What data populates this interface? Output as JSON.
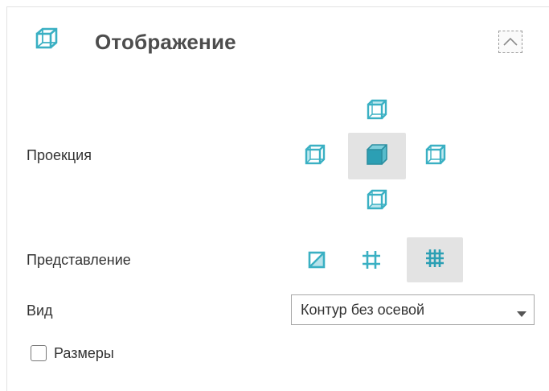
{
  "panel": {
    "title": "Отображение",
    "header_icon": "cube-wireframe-icon",
    "collapse_icon": "chevron-up-icon"
  },
  "projection": {
    "label": "Проекция",
    "options": [
      {
        "icon": "cube-top-view-icon",
        "selected": false
      },
      {
        "icon": "cube-left-view-icon",
        "selected": false
      },
      {
        "icon": "cube-front-view-icon",
        "selected": true
      },
      {
        "icon": "cube-right-view-icon",
        "selected": false
      },
      {
        "icon": "cube-bottom-view-icon",
        "selected": false
      }
    ]
  },
  "representation": {
    "label": "Представление",
    "options": [
      {
        "icon": "shaded-square-icon",
        "selected": false
      },
      {
        "icon": "frame-grid-icon",
        "selected": false
      },
      {
        "icon": "full-grid-icon",
        "selected": true
      }
    ]
  },
  "view": {
    "label": "Вид",
    "selected_value": "Контур без осевой"
  },
  "dimensions": {
    "label": "Размеры",
    "checked": false
  },
  "colors": {
    "accent": "#3ab0c3",
    "accent_dark": "#2c8fa1",
    "selected_bg": "#e3e3e3",
    "title_text": "#4d4d4d"
  }
}
